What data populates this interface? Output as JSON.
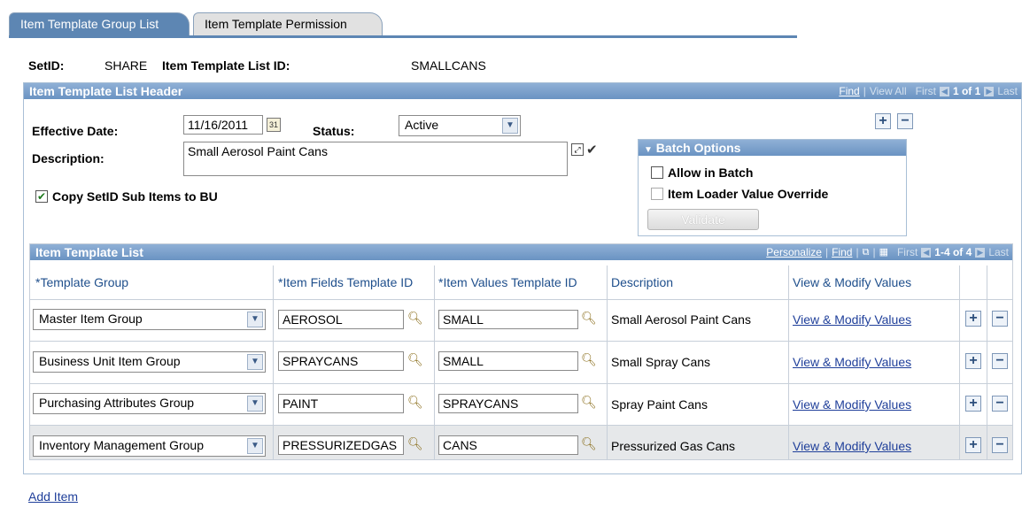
{
  "tabs": [
    {
      "label": "Item Template Group List",
      "active": true
    },
    {
      "label": "Item Template Permission",
      "active": false
    }
  ],
  "header": {
    "setid_label": "SetID:",
    "setid_value": "SHARE",
    "list_id_label": "Item Template List ID:",
    "list_id_value": "SMALLCANS"
  },
  "list_header": {
    "title": "Item Template List Header",
    "nav": {
      "find": "Find",
      "view_all": "View All",
      "first": "First",
      "count": "1 of 1",
      "last": "Last"
    },
    "effective_date_label": "Effective Date:",
    "effective_date_value": "11/16/2011",
    "status_label": "Status:",
    "status_value": "Active",
    "description_label": "Description:",
    "description_value": "Small Aerosol Paint Cans",
    "copy_label": "Copy SetID Sub Items to BU",
    "copy_checked": true
  },
  "batch": {
    "title": "Batch Options",
    "allow_label": "Allow in Batch",
    "override_label": "Item Loader Value Override",
    "validate_label": "Validate"
  },
  "template_list": {
    "title": "Item Template List",
    "nav": {
      "personalize": "Personalize",
      "find": "Find",
      "first": "First",
      "count": "1-4 of 4",
      "last": "Last"
    },
    "columns": [
      "*Template Group",
      "*Item Fields Template ID",
      "*Item Values Template ID",
      "Description",
      "View & Modify Values"
    ],
    "rows": [
      {
        "group": "Master Item Group",
        "fields": "AEROSOL",
        "values": "SMALL",
        "description": "Small Aerosol Paint Cans",
        "link": "View & Modify Values"
      },
      {
        "group": "Business Unit Item Group",
        "fields": "SPRAYCANS",
        "values": "SMALL",
        "description": "Small Spray Cans",
        "link": "View & Modify Values"
      },
      {
        "group": "Purchasing Attributes Group",
        "fields": "PAINT",
        "values": "SPRAYCANS",
        "description": "Spray Paint Cans",
        "link": "View & Modify Values"
      },
      {
        "group": "Inventory Management Group",
        "fields": "PRESSURIZEDGAS",
        "values": "CANS",
        "description": "Pressurized Gas Cans",
        "link": "View & Modify Values"
      }
    ]
  },
  "add_item": "Add Item"
}
